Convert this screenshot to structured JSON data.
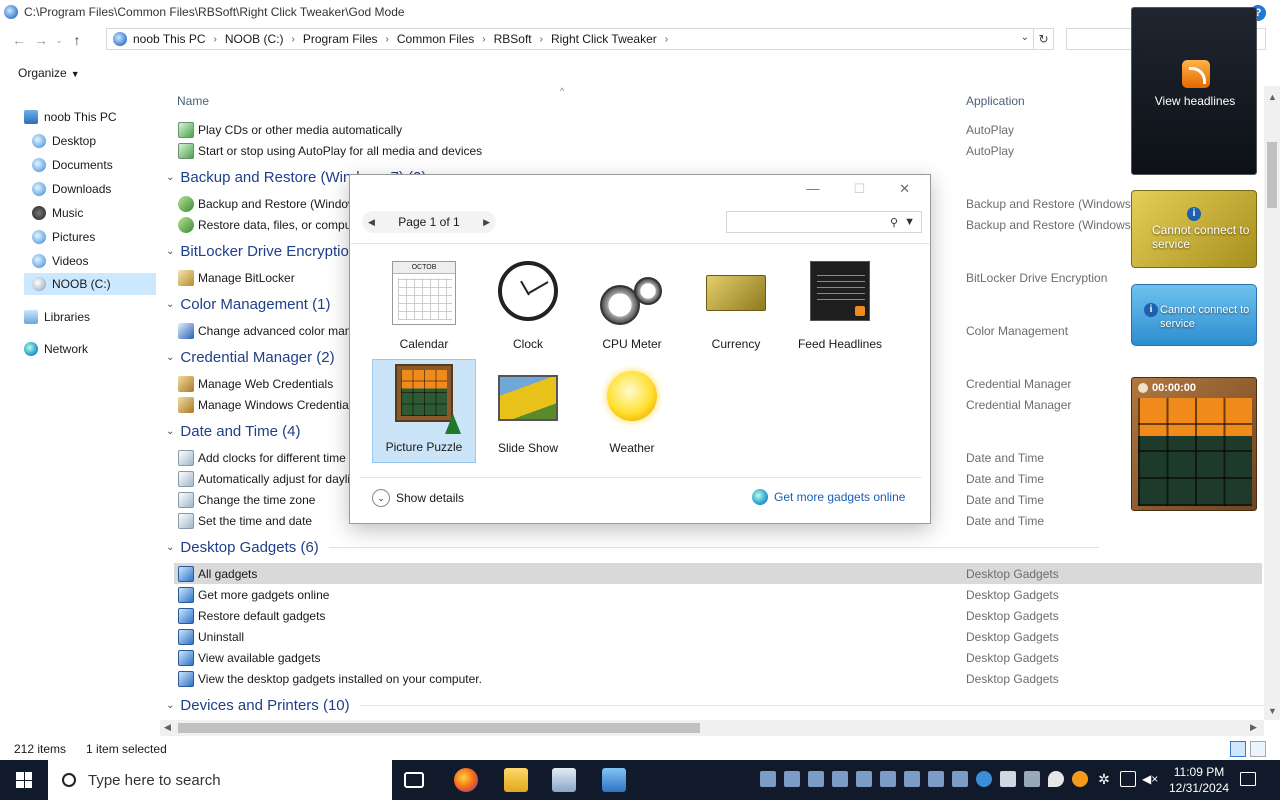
{
  "window": {
    "title": "C:\\Program Files\\Common Files\\RBSoft\\Right Click Tweaker\\God Mode"
  },
  "address": {
    "crumbs": [
      "noob This PC",
      "NOOB (C:)",
      "Program Files",
      "Common Files",
      "RBSoft",
      "Right Click Tweaker"
    ]
  },
  "toolbar": {
    "organize": "Organize"
  },
  "nav": {
    "items": [
      {
        "label": "noob This PC",
        "icon": "pc-icon"
      },
      {
        "label": "Desktop",
        "icon": "desktop-icon"
      },
      {
        "label": "Documents",
        "icon": "documents-icon"
      },
      {
        "label": "Downloads",
        "icon": "downloads-icon"
      },
      {
        "label": "Music",
        "icon": "music-icon"
      },
      {
        "label": "Pictures",
        "icon": "pictures-icon"
      },
      {
        "label": "Videos",
        "icon": "videos-icon"
      },
      {
        "label": "NOOB (C:)",
        "icon": "drive-icon"
      },
      {
        "label": "Libraries",
        "icon": "libraries-icon"
      },
      {
        "label": "Network",
        "icon": "network-icon"
      }
    ]
  },
  "columns": {
    "name": "Name",
    "application": "Application"
  },
  "content": {
    "rows_top": [
      {
        "name": "Play CDs or other media automatically",
        "app": "AutoPlay"
      },
      {
        "name": "Start or stop using AutoPlay for all media and devices",
        "app": "AutoPlay"
      }
    ],
    "groups": [
      {
        "name": "Backup and Restore (Windows 7) (2)",
        "rows": [
          {
            "name": "Backup and Restore (Windows 7)",
            "app": "Backup and Restore (Windows 7)"
          },
          {
            "name": "Restore data, files, or computer from backup (Windows 7)",
            "app": "Backup and Restore (Windows 7)"
          }
        ]
      },
      {
        "name": "BitLocker Drive Encryption (1)",
        "rows": [
          {
            "name": "Manage BitLocker",
            "app": "BitLocker Drive Encryption"
          }
        ]
      },
      {
        "name": "Color Management (1)",
        "rows": [
          {
            "name": "Change advanced color management settings for displays, scanners, and printers",
            "app": "Color Management"
          }
        ]
      },
      {
        "name": "Credential Manager (2)",
        "rows": [
          {
            "name": "Manage Web Credentials",
            "app": "Credential Manager"
          },
          {
            "name": "Manage Windows Credentials",
            "app": "Credential Manager"
          }
        ]
      },
      {
        "name": "Date and Time (4)",
        "rows": [
          {
            "name": "Add clocks for different time zones",
            "app": "Date and Time"
          },
          {
            "name": "Automatically adjust for daylight saving time",
            "app": "Date and Time"
          },
          {
            "name": "Change the time zone",
            "app": "Date and Time"
          },
          {
            "name": "Set the time and date",
            "app": "Date and Time"
          }
        ]
      },
      {
        "name": "Desktop Gadgets (6)",
        "rows": [
          {
            "name": "All gadgets",
            "app": "Desktop Gadgets"
          },
          {
            "name": "Get more gadgets online",
            "app": "Desktop Gadgets"
          },
          {
            "name": "Restore default gadgets",
            "app": "Desktop Gadgets"
          },
          {
            "name": "Uninstall",
            "app": "Desktop Gadgets"
          },
          {
            "name": "View available gadgets",
            "app": "Desktop Gadgets"
          },
          {
            "name": "View the desktop gadgets installed on your computer.",
            "app": "Desktop Gadgets"
          }
        ]
      },
      {
        "name": "Devices and Printers (10)",
        "rows": []
      }
    ]
  },
  "status": {
    "count": "212 items",
    "selected": "1 item selected"
  },
  "dialog": {
    "page": "Page 1 of 1",
    "gadgets": [
      "Calendar",
      "Clock",
      "CPU Meter",
      "Currency",
      "Feed Headlines",
      "Picture Puzzle",
      "Slide Show",
      "Weather"
    ],
    "calendar_month": "OCTOB",
    "show_details": "Show details",
    "get_more": "Get more gadgets online"
  },
  "desktop_gadgets": {
    "feed_text": "View headlines",
    "currency_text": "Cannot connect to service",
    "stock_text": "Cannot connect to service",
    "puzzle_time": "00:00:00"
  },
  "taskbar": {
    "search_placeholder": "Type here to search",
    "time": "11:09 PM",
    "date": "12/31/2024"
  }
}
